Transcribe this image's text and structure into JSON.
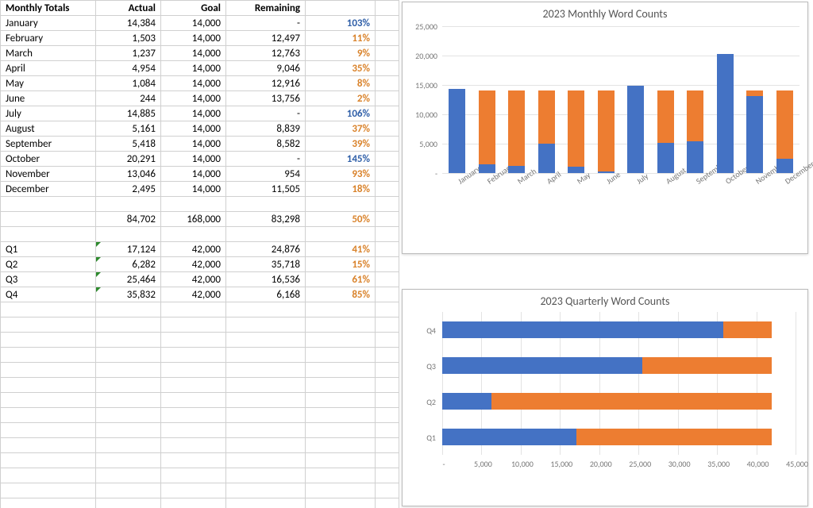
{
  "headers": {
    "monthly_totals": "Monthly Totals",
    "actual": "Actual",
    "goal": "Goal",
    "remaining": "Remaining"
  },
  "months": [
    {
      "name": "January",
      "actual": "14,384",
      "goal": "14,000",
      "remaining": "-",
      "pct": "103%",
      "over": true
    },
    {
      "name": "February",
      "actual": "1,503",
      "goal": "14,000",
      "remaining": "12,497",
      "pct": "11%",
      "over": false
    },
    {
      "name": "March",
      "actual": "1,237",
      "goal": "14,000",
      "remaining": "12,763",
      "pct": "9%",
      "over": false
    },
    {
      "name": "April",
      "actual": "4,954",
      "goal": "14,000",
      "remaining": "9,046",
      "pct": "35%",
      "over": false
    },
    {
      "name": "May",
      "actual": "1,084",
      "goal": "14,000",
      "remaining": "12,916",
      "pct": "8%",
      "over": false
    },
    {
      "name": "June",
      "actual": "244",
      "goal": "14,000",
      "remaining": "13,756",
      "pct": "2%",
      "over": false
    },
    {
      "name": "July",
      "actual": "14,885",
      "goal": "14,000",
      "remaining": "-",
      "pct": "106%",
      "over": true
    },
    {
      "name": "August",
      "actual": "5,161",
      "goal": "14,000",
      "remaining": "8,839",
      "pct": "37%",
      "over": false
    },
    {
      "name": "September",
      "actual": "5,418",
      "goal": "14,000",
      "remaining": "8,582",
      "pct": "39%",
      "over": false
    },
    {
      "name": "October",
      "actual": "20,291",
      "goal": "14,000",
      "remaining": "-",
      "pct": "145%",
      "over": true
    },
    {
      "name": "November",
      "actual": "13,046",
      "goal": "14,000",
      "remaining": "954",
      "pct": "93%",
      "over": false
    },
    {
      "name": "December",
      "actual": "2,495",
      "goal": "14,000",
      "remaining": "11,505",
      "pct": "18%",
      "over": false
    }
  ],
  "year_total": {
    "actual": "84,702",
    "goal": "168,000",
    "remaining": "83,298",
    "pct": "50%"
  },
  "quarters": [
    {
      "name": "Q1",
      "actual": "17,124",
      "goal": "42,000",
      "remaining": "24,876",
      "pct": "41%"
    },
    {
      "name": "Q2",
      "actual": "6,282",
      "goal": "42,000",
      "remaining": "35,718",
      "pct": "15%"
    },
    {
      "name": "Q3",
      "actual": "25,464",
      "goal": "42,000",
      "remaining": "16,536",
      "pct": "61%"
    },
    {
      "name": "Q4",
      "actual": "35,832",
      "goal": "42,000",
      "remaining": "6,168",
      "pct": "85%"
    }
  ],
  "chart_titles": {
    "monthly": "2023 Monthly Word Counts",
    "quarterly": "2023 Quarterly Word Counts"
  },
  "chart_data": [
    {
      "id": "monthly",
      "type": "bar",
      "orientation": "vertical",
      "stacked": true,
      "title": "2023 Monthly Word Counts",
      "categories": [
        "January",
        "February",
        "March",
        "April",
        "May",
        "June",
        "July",
        "August",
        "September",
        "October",
        "November",
        "December"
      ],
      "series": [
        {
          "name": "Actual",
          "values": [
            14384,
            1503,
            1237,
            4954,
            1084,
            244,
            14885,
            5161,
            5418,
            20291,
            13046,
            2495
          ]
        },
        {
          "name": "Remaining",
          "values": [
            0,
            12497,
            12763,
            9046,
            12916,
            13756,
            0,
            8839,
            8582,
            0,
            954,
            11505
          ]
        }
      ],
      "ylim": [
        0,
        25000
      ],
      "yticks": [
        "-",
        "5,000",
        "10,000",
        "15,000",
        "20,000",
        "25,000"
      ]
    },
    {
      "id": "quarterly",
      "type": "bar",
      "orientation": "horizontal",
      "stacked": true,
      "title": "2023 Quarterly Word Counts",
      "categories": [
        "Q1",
        "Q2",
        "Q3",
        "Q4"
      ],
      "series": [
        {
          "name": "Actual",
          "values": [
            17124,
            6282,
            25464,
            35832
          ]
        },
        {
          "name": "Remaining",
          "values": [
            24876,
            35718,
            16536,
            6168
          ]
        }
      ],
      "xlim": [
        0,
        45000
      ],
      "xticks": [
        "-",
        "5,000",
        "10,000",
        "15,000",
        "20,000",
        "25,000",
        "30,000",
        "35,000",
        "40,000",
        "45,000"
      ]
    }
  ]
}
